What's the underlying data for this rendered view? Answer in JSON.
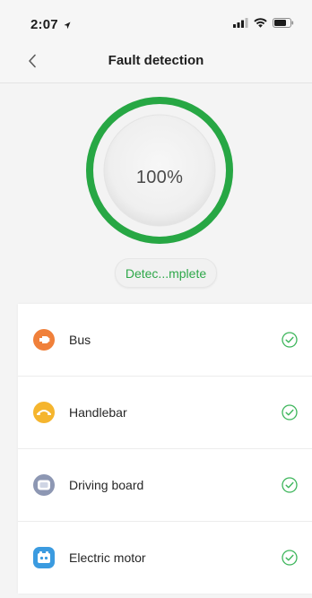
{
  "status_bar": {
    "time": "2:07"
  },
  "nav": {
    "title": "Fault detection"
  },
  "progress": {
    "value": 100,
    "label": "100%",
    "ring_color": "#27a744",
    "status_text": "Detec...mplete"
  },
  "devices": [
    {
      "label": "Bus",
      "icon": "plug-icon",
      "icon_color": "#f0803a",
      "checked": true
    },
    {
      "label": "Handlebar",
      "icon": "handlebar-icon",
      "icon_color": "#f5b52e",
      "checked": true
    },
    {
      "label": "Driving board",
      "icon": "driving-board-icon",
      "icon_color": "#8d97b3",
      "checked": true
    },
    {
      "label": "Electric motor",
      "icon": "electric-motor-icon",
      "icon_color": "#3b9be0",
      "checked": true
    }
  ],
  "colors": {
    "accent": "#2fa84a",
    "check": "#3cb55a"
  }
}
